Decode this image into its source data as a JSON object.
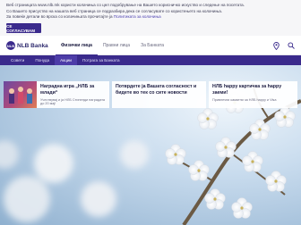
{
  "cookie": {
    "line1": "Веб страницата www.nlb.mk користи колачиња со цел подобрување на Вашето корисничко искуство и следење на посетата.",
    "line2": "Со Вашето присуство на нашата веб страница се подразбира дека се согласувате со користењето на колачиња.",
    "line3_prefix": "За повеќе детали во врска со колачињата прочитајте ја ",
    "line3_link": "Политиката за колачиња",
    "accept_label": "СЕ СОГЛАСУВАМ"
  },
  "header": {
    "logo_mark": "NLB",
    "logo_text": "NLB Banka",
    "nav": [
      "Физички лица",
      "Правни лица",
      "За Банката"
    ]
  },
  "subnav": [
    "Совети",
    "Понуда",
    "Акции",
    "Потрага за Банката"
  ],
  "cards": [
    {
      "title": "Наградна игра „НЛБ за млади“",
      "sub": "Учествувај и ја НЛБ Стипенди наградата до 20 мај!"
    },
    {
      "title": "Потврдете ја Вашата согласност и бидете во тек со сите новости",
      "sub": ""
    },
    {
      "title": "НЛБ happy картичка за happy заеми!",
      "sub": "Привлечни каматни за НЛБ happy и Visa"
    }
  ],
  "colors": {
    "brand": "#3a2a8c",
    "brand_light": "#4d3ca8"
  }
}
